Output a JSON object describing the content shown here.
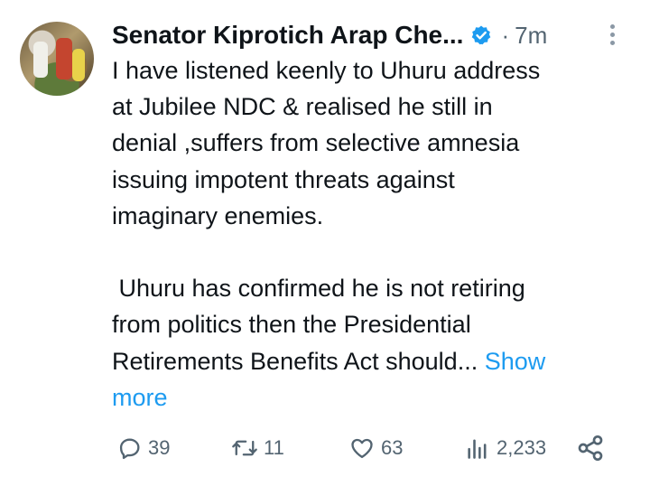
{
  "author": {
    "name": "Senator Kiprotich Arap Che...",
    "separator": "·",
    "time": "7m"
  },
  "tweet": {
    "lines": [
      "I have listened keenly to Uhuru address",
      "at Jubilee NDC & realised he still in",
      "denial ,suffers from selective amnesia",
      "issuing impotent threats against",
      "imaginary enemies.",
      "",
      " Uhuru has confirmed he is not retiring",
      "from politics then the Presidential",
      "Retirements Benefits Act should..."
    ],
    "show_more_part1": "Show",
    "show_more_part2": "more"
  },
  "actions": {
    "replies": "39",
    "reposts": "11",
    "likes": "63",
    "views": "2,233"
  },
  "colors": {
    "accent": "#1d9bf0",
    "muted": "#536471",
    "text": "#0f1419"
  },
  "icons": [
    "verified-badge-icon",
    "more-options-icon",
    "reply-icon",
    "repost-icon",
    "like-icon",
    "views-icon",
    "share-icon"
  ]
}
